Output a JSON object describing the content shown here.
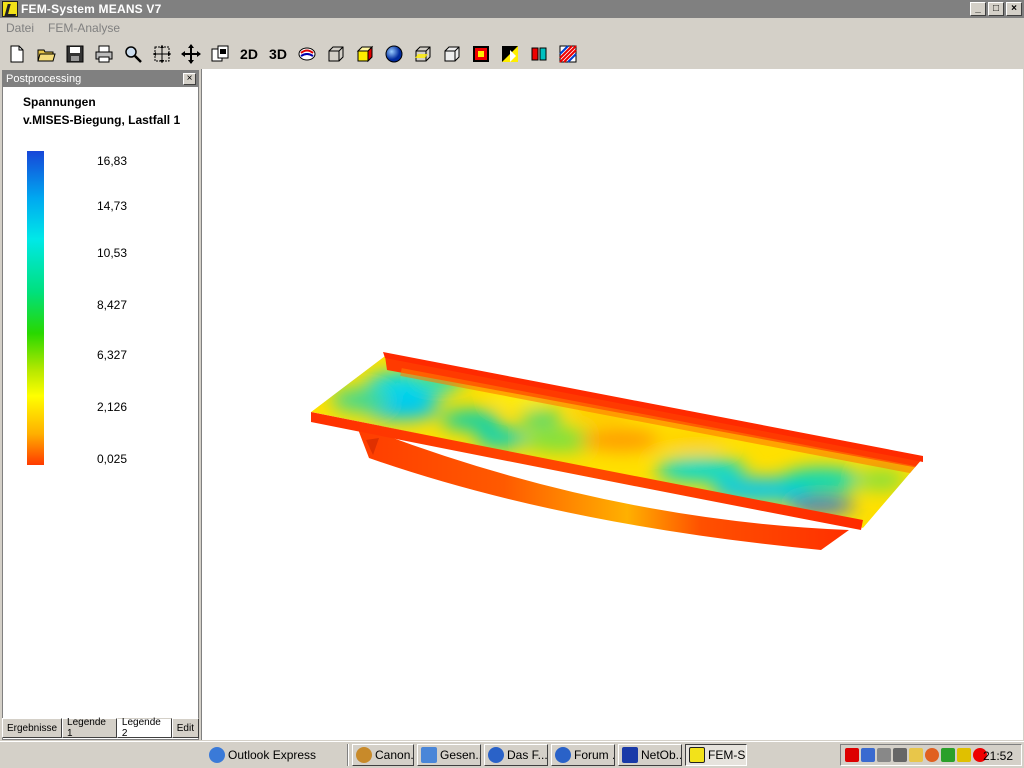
{
  "window": {
    "title": "FEM-System MEANS V7",
    "buttons": {
      "minimize": "_",
      "maximize": "□",
      "close": "×"
    }
  },
  "menu": {
    "items": [
      "Datei",
      "FEM-Analyse"
    ]
  },
  "toolbar": {
    "icons": [
      "new-file-icon",
      "open-folder-icon",
      "save-icon",
      "print-icon",
      "zoom-icon",
      "fit-view-icon",
      "pan-icon",
      "copy-view-icon"
    ],
    "label_2d": "2D",
    "label_3d": "3D",
    "icons_after": [
      "color-tool-icon",
      "wireframe-cube-icon",
      "solid-cube-icon",
      "sphere-icon",
      "section-cube-icon",
      "outline-cube-icon",
      "contour-icon",
      "stress-plot-icon",
      "mirror-icon",
      "stripes-icon"
    ]
  },
  "panel": {
    "title": "Postprocessing",
    "close_label": "×",
    "legend_title": "Spannungen",
    "legend_subtitle": "v.MISES-Biegung, Lastfall  1",
    "ticks": [
      "16,83",
      "14,73",
      "10,53",
      "8,427",
      "6,327",
      "2,126",
      "0,025"
    ],
    "tabs": [
      "Ergebnisse",
      "Legende 1",
      "Legende 2",
      "Edit"
    ],
    "active_tab": "Legende 2"
  },
  "colors": {
    "legend_top": "#1746d8",
    "legend_bottom": "#ff3a00"
  },
  "taskbar": {
    "quicklaunch": "Outlook Express",
    "tasks": [
      "Canon...",
      "Gesen...",
      "Das F...",
      "Forum ...",
      "NetOb...",
      "FEM-S..."
    ],
    "active_task": "FEM-S...",
    "clock": "21:52"
  }
}
